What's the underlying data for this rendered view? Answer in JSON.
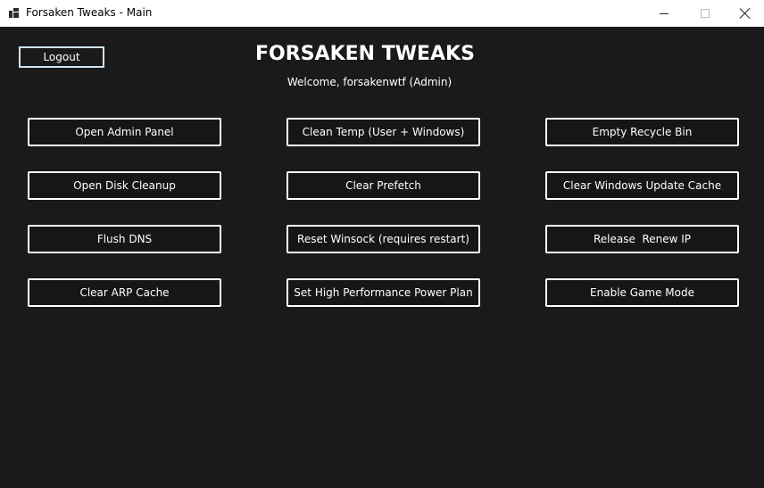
{
  "window": {
    "title": "Forsaken Tweaks - Main"
  },
  "header": {
    "logout_label": "Logout",
    "title": "FORSAKEN TWEAKS",
    "welcome": "Welcome, forsakenwtf (Admin)"
  },
  "buttons": {
    "open_admin_panel": "Open Admin Panel",
    "clean_temp": "Clean Temp (User + Windows)",
    "empty_recycle_bin": "Empty Recycle Bin",
    "open_disk_cleanup": "Open Disk Cleanup",
    "clear_prefetch": "Clear Prefetch",
    "clear_windows_update_cache": "Clear Windows Update Cache",
    "flush_dns": "Flush DNS",
    "reset_winsock": "Reset Winsock (requires restart)",
    "release_renew_ip": "Release  Renew IP",
    "clear_arp_cache": "Clear ARP Cache",
    "set_high_performance": "Set High Performance Power Plan",
    "enable_game_mode": "Enable Game Mode"
  },
  "colors": {
    "background": "#1a1a1a",
    "button_border": "#ffffff",
    "logout_border": "#cfe3f2"
  },
  "icons": {
    "app": "app-window-icon",
    "minimize": "minimize-icon",
    "maximize": "maximize-icon",
    "close": "close-icon"
  }
}
